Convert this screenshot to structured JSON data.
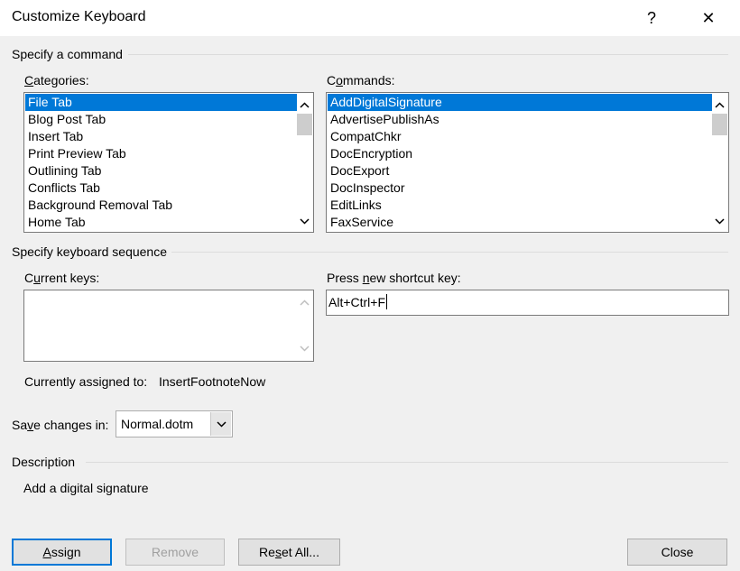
{
  "window": {
    "title": "Customize Keyboard",
    "help_glyph": "?",
    "close_glyph": "✕"
  },
  "command_section": {
    "heading": "Specify a command",
    "categories": {
      "label_prefix": "",
      "label_accel": "C",
      "label_rest": "ategories:",
      "selected_index": 0,
      "items": [
        "File Tab",
        "Blog Post Tab",
        "Insert Tab",
        "Print Preview Tab",
        "Outlining Tab",
        "Conflicts Tab",
        "Background Removal Tab",
        "Home Tab"
      ]
    },
    "commands": {
      "label_prefix": "C",
      "label_accel": "o",
      "label_rest": "mmands:",
      "selected_index": 0,
      "items": [
        "AddDigitalSignature",
        "AdvertisePublishAs",
        "CompatChkr",
        "DocEncryption",
        "DocExport",
        "DocInspector",
        "EditLinks",
        "FaxService"
      ]
    }
  },
  "keyboard_section": {
    "heading": "Specify keyboard sequence",
    "current_keys": {
      "label_prefix": "C",
      "label_accel": "u",
      "label_rest": "rrent keys:",
      "values": []
    },
    "new_shortcut": {
      "label_prefix": "Press ",
      "label_accel": "n",
      "label_rest": "ew shortcut key:",
      "value": "Alt+Ctrl+F"
    },
    "assigned_label": "Currently assigned to:",
    "assigned_value": "InsertFootnoteNow"
  },
  "save_changes": {
    "label_prefix": "Sa",
    "label_accel": "v",
    "label_rest": "e changes in:",
    "value": "Normal.dotm"
  },
  "description": {
    "heading": "Description",
    "text": "Add a digital signature"
  },
  "buttons": {
    "assign": {
      "accel": "A",
      "rest": "ssign"
    },
    "remove": {
      "label": "Remove"
    },
    "reset_all": {
      "prefix": "Re",
      "accel": "s",
      "rest": "et All..."
    },
    "close": {
      "label": "Close"
    }
  },
  "colors": {
    "selection": "#0078d7",
    "dialog_bg": "#f0f0f0"
  }
}
